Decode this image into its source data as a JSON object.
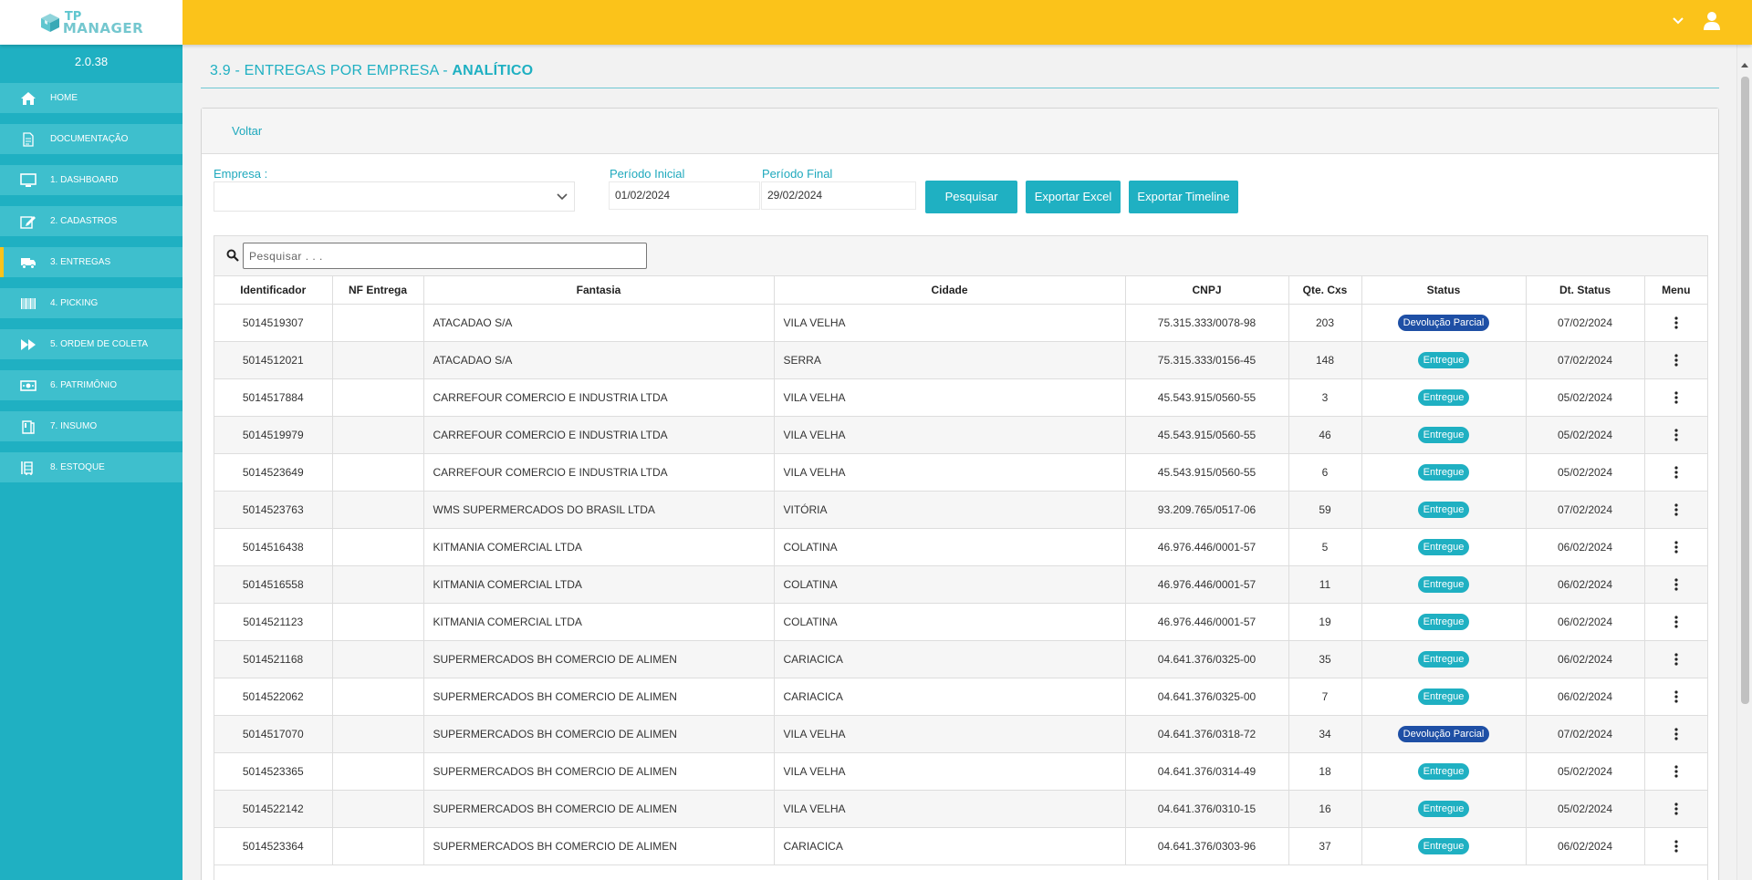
{
  "app": {
    "logo_tp": "TP",
    "logo_manager": "MANAGER",
    "version": "2.0.38"
  },
  "colors": {
    "primary": "#1fb0c2",
    "header": "#fbc31a",
    "badge_entregue": "#1fb0c2",
    "badge_devolucao": "#1e4fa5"
  },
  "sidebar": {
    "items": [
      {
        "label": "HOME",
        "icon": "home-icon"
      },
      {
        "label": "DOCUMENTAÇÃO",
        "icon": "document-icon"
      },
      {
        "label": "1. DASHBOARD",
        "icon": "monitor-icon"
      },
      {
        "label": "2. CADASTROS",
        "icon": "edit-icon"
      },
      {
        "label": "3. ENTREGAS",
        "icon": "truck-icon",
        "active": true
      },
      {
        "label": "4. PICKING",
        "icon": "barcode-icon"
      },
      {
        "label": "5. ORDEM DE COLETA",
        "icon": "fast-forward-icon"
      },
      {
        "label": "6. PATRIMÔNIO",
        "icon": "money-icon"
      },
      {
        "label": "7. INSUMO",
        "icon": "box-icon"
      },
      {
        "label": "8. ESTOQUE",
        "icon": "warehouse-icon"
      }
    ]
  },
  "page": {
    "title_prefix": "3.9 - ENTREGAS POR EMPRESA - ",
    "title_bold": "ANALÍTICO",
    "back_label": "Voltar"
  },
  "filters": {
    "empresa_label": "Empresa :",
    "empresa_value": "",
    "periodo_inicial_label": "Período Inicial",
    "periodo_inicial_value": "01/02/2024",
    "periodo_final_label": "Período Final",
    "periodo_final_value": "29/02/2024",
    "btn_pesquisar": "Pesquisar",
    "btn_excel": "Exportar Excel",
    "btn_timeline": "Exportar Timeline"
  },
  "grid": {
    "search_placeholder": "Pesquisar . . .",
    "columns": [
      "Identificador",
      "NF Entrega",
      "Fantasia",
      "Cidade",
      "CNPJ",
      "Qte. Cxs",
      "Status",
      "Dt. Status",
      "Menu"
    ],
    "rows": [
      {
        "id": "5014519307",
        "nf": "",
        "fantasia": "ATACADAO S/A",
        "cidade": "VILA VELHA",
        "cnpj": "75.315.333/0078-98",
        "qte": "203",
        "status": "Devolução Parcial",
        "dt": "07/02/2024"
      },
      {
        "id": "5014512021",
        "nf": "",
        "fantasia": "ATACADAO S/A",
        "cidade": "SERRA",
        "cnpj": "75.315.333/0156-45",
        "qte": "148",
        "status": "Entregue",
        "dt": "07/02/2024"
      },
      {
        "id": "5014517884",
        "nf": "",
        "fantasia": "CARREFOUR COMERCIO E INDUSTRIA LTDA",
        "cidade": "VILA VELHA",
        "cnpj": "45.543.915/0560-55",
        "qte": "3",
        "status": "Entregue",
        "dt": "05/02/2024"
      },
      {
        "id": "5014519979",
        "nf": "",
        "fantasia": "CARREFOUR COMERCIO E INDUSTRIA LTDA",
        "cidade": "VILA VELHA",
        "cnpj": "45.543.915/0560-55",
        "qte": "46",
        "status": "Entregue",
        "dt": "05/02/2024"
      },
      {
        "id": "5014523649",
        "nf": "",
        "fantasia": "CARREFOUR COMERCIO E INDUSTRIA LTDA",
        "cidade": "VILA VELHA",
        "cnpj": "45.543.915/0560-55",
        "qte": "6",
        "status": "Entregue",
        "dt": "05/02/2024"
      },
      {
        "id": "5014523763",
        "nf": "",
        "fantasia": "WMS SUPERMERCADOS DO BRASIL LTDA",
        "cidade": "VITÓRIA",
        "cnpj": "93.209.765/0517-06",
        "qte": "59",
        "status": "Entregue",
        "dt": "07/02/2024"
      },
      {
        "id": "5014516438",
        "nf": "",
        "fantasia": "KITMANIA COMERCIAL LTDA",
        "cidade": "COLATINA",
        "cnpj": "46.976.446/0001-57",
        "qte": "5",
        "status": "Entregue",
        "dt": "06/02/2024"
      },
      {
        "id": "5014516558",
        "nf": "",
        "fantasia": "KITMANIA COMERCIAL LTDA",
        "cidade": "COLATINA",
        "cnpj": "46.976.446/0001-57",
        "qte": "11",
        "status": "Entregue",
        "dt": "06/02/2024"
      },
      {
        "id": "5014521123",
        "nf": "",
        "fantasia": "KITMANIA COMERCIAL LTDA",
        "cidade": "COLATINA",
        "cnpj": "46.976.446/0001-57",
        "qte": "19",
        "status": "Entregue",
        "dt": "06/02/2024"
      },
      {
        "id": "5014521168",
        "nf": "",
        "fantasia": "SUPERMERCADOS BH COMERCIO DE ALIMEN",
        "cidade": "CARIACICA",
        "cnpj": "04.641.376/0325-00",
        "qte": "35",
        "status": "Entregue",
        "dt": "06/02/2024"
      },
      {
        "id": "5014522062",
        "nf": "",
        "fantasia": "SUPERMERCADOS BH COMERCIO DE ALIMEN",
        "cidade": "CARIACICA",
        "cnpj": "04.641.376/0325-00",
        "qte": "7",
        "status": "Entregue",
        "dt": "06/02/2024"
      },
      {
        "id": "5014517070",
        "nf": "",
        "fantasia": "SUPERMERCADOS BH COMERCIO DE ALIMEN",
        "cidade": "VILA VELHA",
        "cnpj": "04.641.376/0318-72",
        "qte": "34",
        "status": "Devolução Parcial",
        "dt": "07/02/2024"
      },
      {
        "id": "5014523365",
        "nf": "",
        "fantasia": "SUPERMERCADOS BH COMERCIO DE ALIMEN",
        "cidade": "VILA VELHA",
        "cnpj": "04.641.376/0314-49",
        "qte": "18",
        "status": "Entregue",
        "dt": "05/02/2024"
      },
      {
        "id": "5014522142",
        "nf": "",
        "fantasia": "SUPERMERCADOS BH COMERCIO DE ALIMEN",
        "cidade": "VILA VELHA",
        "cnpj": "04.641.376/0310-15",
        "qte": "16",
        "status": "Entregue",
        "dt": "05/02/2024"
      },
      {
        "id": "5014523364",
        "nf": "",
        "fantasia": "SUPERMERCADOS BH COMERCIO DE ALIMEN",
        "cidade": "CARIACICA",
        "cnpj": "04.641.376/0303-96",
        "qte": "37",
        "status": "Entregue",
        "dt": "06/02/2024"
      }
    ]
  }
}
